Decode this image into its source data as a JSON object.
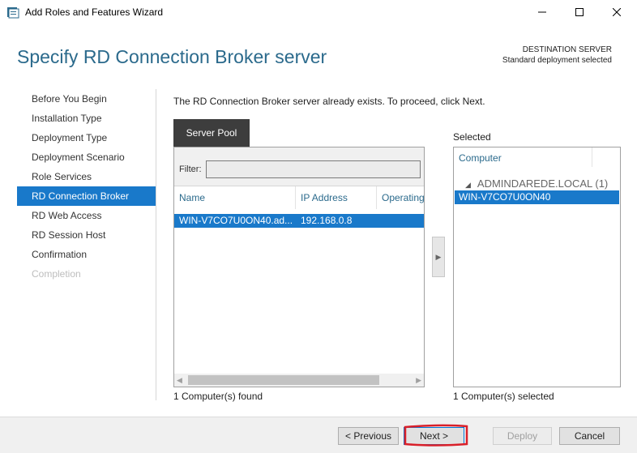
{
  "window": {
    "title": "Add Roles and Features Wizard"
  },
  "header": {
    "title": "Specify RD Connection Broker server",
    "destination_label": "DESTINATION SERVER",
    "destination_value": "Standard deployment selected"
  },
  "nav": {
    "items": [
      {
        "label": "Before You Begin",
        "state": "normal"
      },
      {
        "label": "Installation Type",
        "state": "normal"
      },
      {
        "label": "Deployment Type",
        "state": "normal"
      },
      {
        "label": "Deployment Scenario",
        "state": "normal"
      },
      {
        "label": "Role Services",
        "state": "normal"
      },
      {
        "label": "RD Connection Broker",
        "state": "active"
      },
      {
        "label": "RD Web Access",
        "state": "normal"
      },
      {
        "label": "RD Session Host",
        "state": "normal"
      },
      {
        "label": "Confirmation",
        "state": "normal"
      },
      {
        "label": "Completion",
        "state": "disabled"
      }
    ]
  },
  "content": {
    "message": "The RD Connection Broker server already exists. To proceed, click Next.",
    "tab_label": "Server Pool",
    "filter_label": "Filter:",
    "filter_value": "",
    "columns": [
      "Name",
      "IP Address",
      "Operating"
    ],
    "rows": [
      {
        "name": "WIN-V7CO7U0ON40.ad...",
        "ip": "192.168.0.8",
        "os": ""
      }
    ],
    "found_text": "1 Computer(s) found",
    "add_arrow": "▶"
  },
  "selected": {
    "label": "Selected",
    "column": "Computer",
    "group": "ADMINDAREDE.LOCAL (1)",
    "items": [
      "WIN-V7CO7U0ON40"
    ],
    "count_text": "1 Computer(s) selected"
  },
  "footer": {
    "previous": "< Previous",
    "next": "Next >",
    "deploy": "Deploy",
    "cancel": "Cancel"
  },
  "colors": {
    "accent": "#1979ca",
    "title": "#2b6a8c",
    "tab_bg": "#3d3d3d",
    "annotation": "#d9202a"
  },
  "icons": [
    "wizard-app-icon",
    "minimize-icon",
    "maximize-icon",
    "close-icon",
    "scroll-left-icon",
    "scroll-right-icon",
    "expand-triangle-icon",
    "add-arrow-icon"
  ]
}
